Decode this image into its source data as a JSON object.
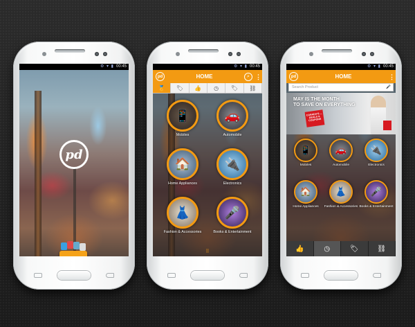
{
  "status_bar": {
    "time": "00:45",
    "icons": "⚙ ▾ ▮"
  },
  "splash": {
    "logo_text": "pd"
  },
  "app_header": {
    "title": "HOME",
    "logo_text": "pd",
    "search_glyph": "⌕",
    "menu_glyph": "⋮"
  },
  "tabs": [
    "🏅",
    "🏷",
    "👍",
    "◷",
    "🏷",
    "⛓"
  ],
  "categories_phone2": [
    {
      "label": "Mobiles",
      "icon": "📱"
    },
    {
      "label": "Automobile",
      "icon": "🚗"
    },
    {
      "label": "Home Appliances",
      "icon": "🏠"
    },
    {
      "label": "Electronics",
      "icon": "🔌"
    },
    {
      "label": "Fashion & Accessories",
      "icon": "👗"
    },
    {
      "label": "Books & Entertainment",
      "icon": "🎤"
    }
  ],
  "pager_dots": "⠿",
  "search": {
    "placeholder": "Search Product",
    "mic_glyph": "🎤"
  },
  "banner": {
    "headline_1": "MAY IS THE MONTH",
    "headline_2": "TO SAVE ON EVERYTHING",
    "badge": "CANADA'S ... DEALS & COUPONS"
  },
  "categories_phone3": [
    {
      "label": "Mobiles",
      "icon": "📱"
    },
    {
      "label": "Automobile",
      "icon": "🚗"
    },
    {
      "label": "Electronics",
      "icon": "🔌"
    },
    {
      "label": "Home Appliances",
      "icon": "🏠"
    },
    {
      "label": "Fashion & Accessories",
      "icon": "👗"
    },
    {
      "label": "Books & Entertainment",
      "icon": "🎤"
    }
  ],
  "bottom_nav": [
    "👍",
    "◷",
    "🏷",
    "⛓"
  ],
  "colors": {
    "accent": "#f39a12",
    "dark": "#3b3b3b"
  }
}
